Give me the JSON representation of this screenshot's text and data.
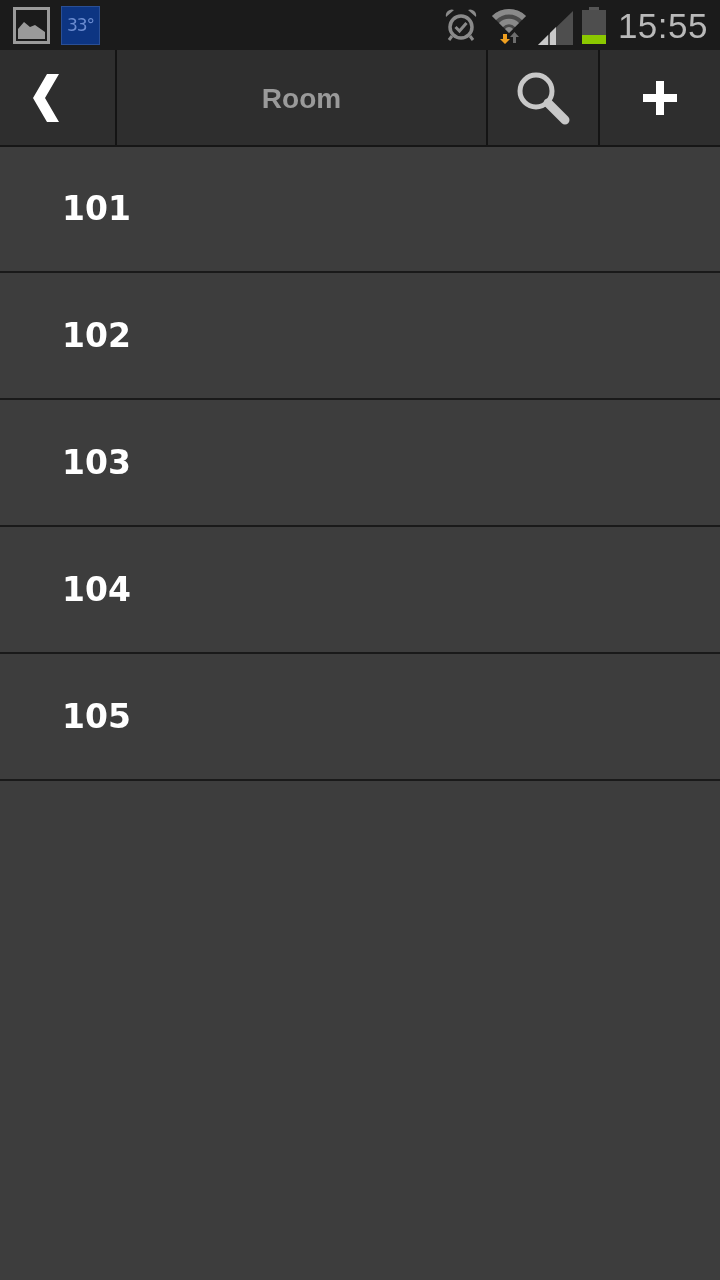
{
  "status_bar": {
    "weather": "33°",
    "time": "15:55"
  },
  "toolbar": {
    "title": "Room"
  },
  "rooms": [
    {
      "label": "101"
    },
    {
      "label": "102"
    },
    {
      "label": "103"
    },
    {
      "label": "104"
    },
    {
      "label": "105"
    }
  ]
}
